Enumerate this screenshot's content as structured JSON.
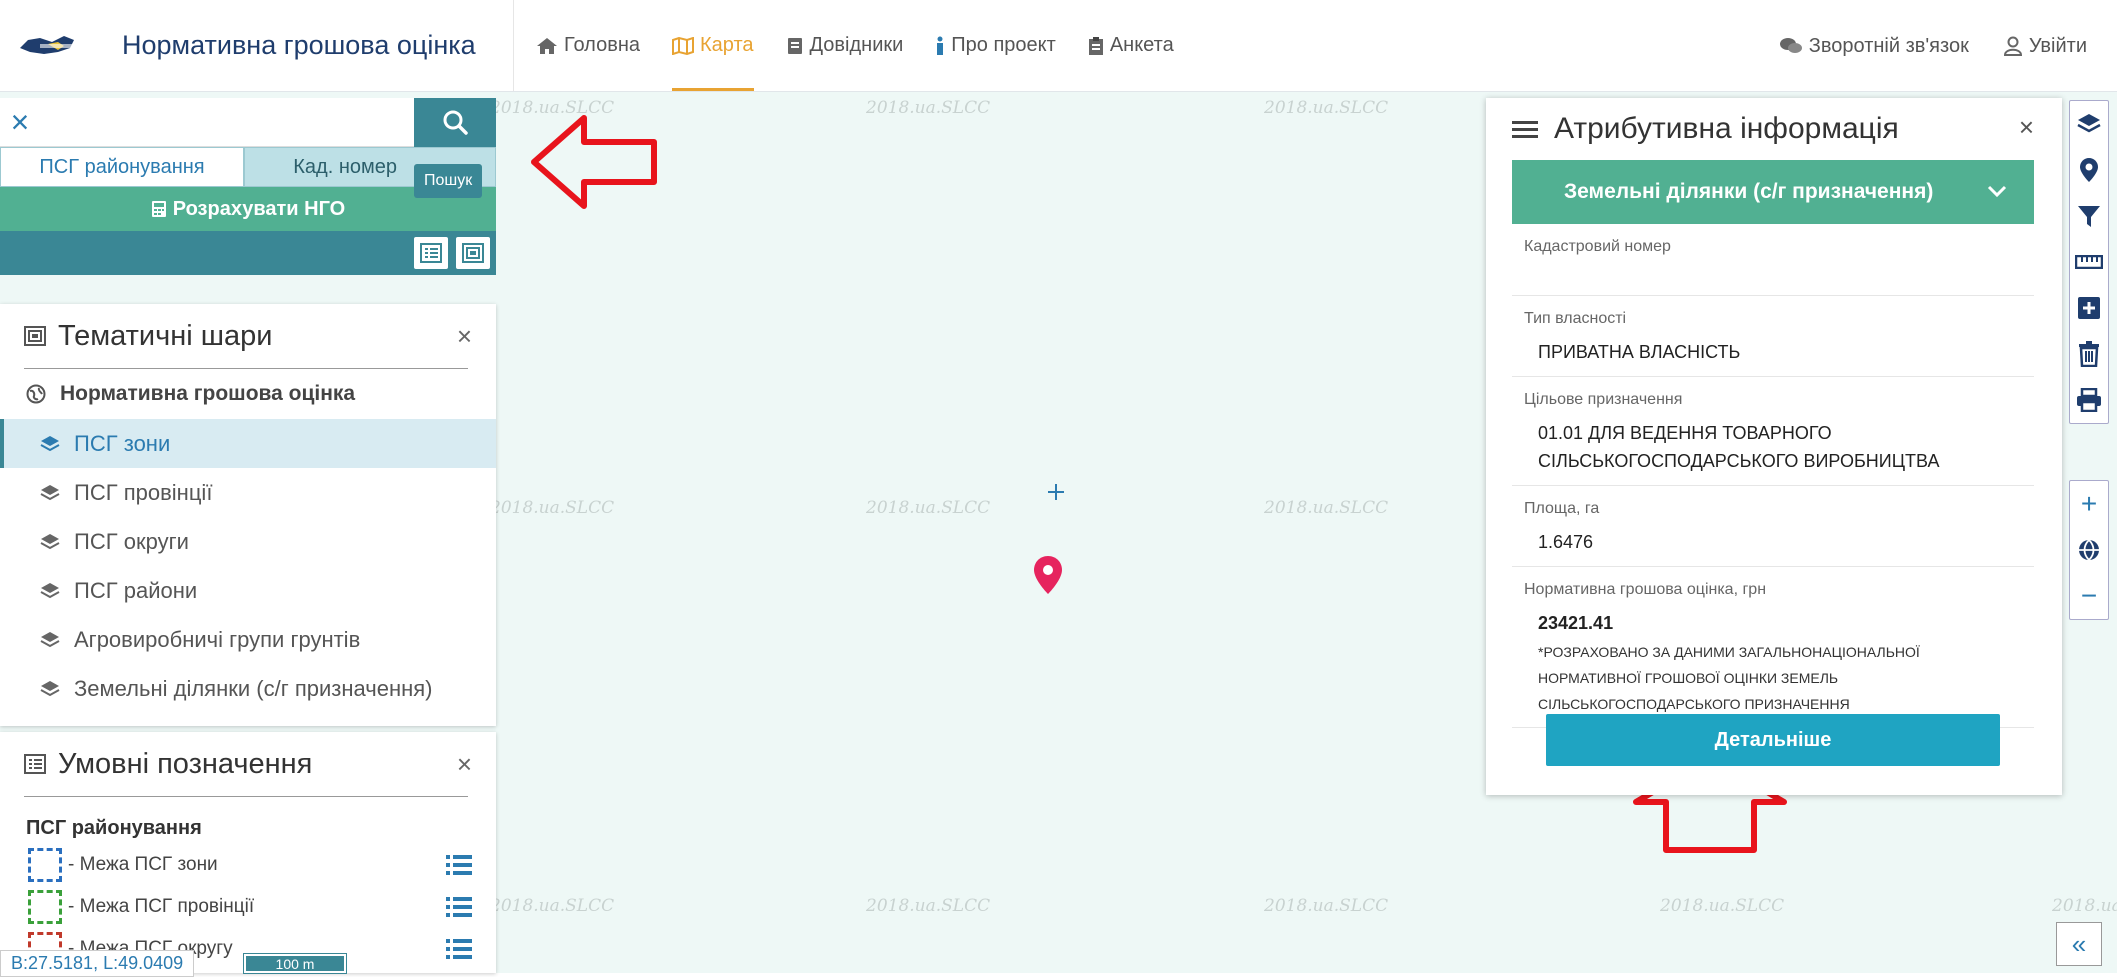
{
  "header": {
    "logo_alt": "ДЕРЖГЕОКАДАСТР",
    "title": "Нормативна грошова оцінка",
    "nav": [
      {
        "label": "Головна",
        "icon": "home-icon"
      },
      {
        "label": "Карта",
        "icon": "map-icon",
        "active": true
      },
      {
        "label": "Довідники",
        "icon": "book-icon"
      },
      {
        "label": "Про проект",
        "icon": "info-icon"
      },
      {
        "label": "Анкета",
        "icon": "clipboard-icon"
      }
    ],
    "feedback": "Зворотній зв'язок",
    "login": "Увійти"
  },
  "search": {
    "placeholder": "",
    "tooltip": "Пошук",
    "tabs": [
      "ПСГ районування",
      "Кад. номер"
    ],
    "calc_button": "Розрахувати НГО"
  },
  "thematic_layers": {
    "title": "Тематичні шари",
    "close": "×",
    "group": "Нормативна грошова оцінка",
    "layers": [
      {
        "label": "ПСГ зони",
        "active": true
      },
      {
        "label": "ПСГ провінції"
      },
      {
        "label": "ПСГ округи"
      },
      {
        "label": "ПСГ райони"
      },
      {
        "label": "Агровиробничі групи грунтів"
      },
      {
        "label": "Земельні ділянки (с/г призначення)"
      }
    ]
  },
  "legend": {
    "title": "Умовні позначення",
    "close": "×",
    "group": "ПСГ районування",
    "items": [
      {
        "label": "- Межа ПСГ зони",
        "color": "#2a6fbf"
      },
      {
        "label": "- Межа ПСГ провінції",
        "color": "#3aa03a"
      },
      {
        "label": "- Межа ПСГ округу",
        "color": "#c0392b"
      }
    ]
  },
  "map": {
    "watermark": "2018.ua.SLCC",
    "coordinates": "B:27.5181, L:49.0409",
    "scale": "100 m",
    "marker_color": "#e6245e"
  },
  "attributes": {
    "title": "Атрибутивна інформація",
    "close": "×",
    "selected_layer": "Земельні ділянки (с/г призначення)",
    "fields": [
      {
        "label": "Кадастровий номер",
        "value": ""
      },
      {
        "label": "Тип власності",
        "value": "ПРИВАТНА ВЛАСНІСТЬ"
      },
      {
        "label": "Цільове призначення",
        "value": "01.01 ДЛЯ ВЕДЕННЯ ТОВАРНОГО СІЛЬСЬКОГОСПОДАРСЬКОГО ВИРОБНИЦТВА"
      },
      {
        "label": "Площа, га",
        "value": "1.6476"
      },
      {
        "label": "Нормативна грошова оцінка, грн",
        "value": "23421.41",
        "note": "*РОЗРАХОВАНО ЗА ДАНИМИ ЗАГАЛЬНОНАЦІОНАЛЬНОЇ НОРМАТИВНОЇ ГРОШОВОЇ ОЦІНКИ ЗЕМЕЛЬ СІЛЬСЬКОГОСПОДАРСЬКОГО ПРИЗНАЧЕННЯ"
      }
    ],
    "details_button": "Детальніше"
  },
  "right_tools": [
    "layers-icon",
    "location-pin-icon",
    "filter-icon",
    "ruler-icon",
    "add-icon",
    "trash-icon",
    "print-icon"
  ],
  "zoom": {
    "in": "+",
    "out": "−",
    "globe": "globe-icon"
  },
  "collapse": "«",
  "colors": {
    "accent": "#3a8795",
    "green": "#51b092",
    "button": "#1fa4c2",
    "annotation_arrow": "#e8141c"
  }
}
